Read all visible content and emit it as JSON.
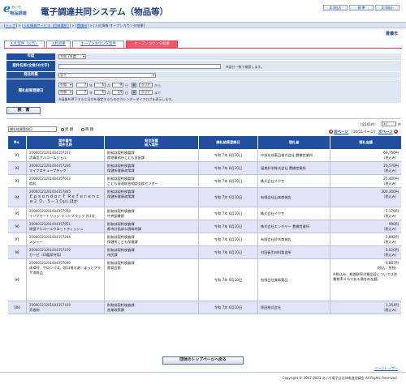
{
  "header": {
    "logo_letter": "e",
    "logo_brand": "あいち",
    "logo_sub": "物品調達",
    "title": "電子調達共同システム（物品等）",
    "buttons": [
      "文字拡大",
      "標 準",
      "文字縮小"
    ]
  },
  "breadcrumb": {
    "items": [
      "トップ",
      "入札情報サービス（団体選択）",
      "豊橋市",
      "入札情報-オープンカウンタ結果"
    ]
  },
  "organization": "豊橋市",
  "tabs": [
    {
      "label": "入札案件（公告）",
      "active": false
    },
    {
      "label": "入札結果",
      "active": false
    },
    {
      "label": "オープンカウンタ案件",
      "active": false
    },
    {
      "label": "オープンカウンタ結果",
      "active": true
    }
  ],
  "search": {
    "year_label": "年度",
    "year_value": "令和 7年度",
    "name_label": "案件名称",
    "name_sub": "(全角50文字)",
    "name_value": "",
    "name_note": "※部分一致で検索します。",
    "dept_label": "発注所属",
    "dept_value": "全て",
    "date_label": "開札結果登録日",
    "from": {
      "era": "令和",
      "year": "7",
      "month": "6",
      "day": "9"
    },
    "to": {
      "era": "令和",
      "year": "7",
      "month": "6",
      "day": "14"
    },
    "unit_year": "年",
    "unit_month": "月",
    "unit_day": "日",
    "clear": "クリア",
    "from_suffix": "から",
    "to_suffix": "まで",
    "cal_icon": "calendar-icon",
    "date_note": "※画像を押下すると日付を指定するためのカレンダーダイアログを表示します。",
    "search_button": "検　索"
  },
  "results": {
    "sort_value": "開札結果登録日",
    "order_asc": "昇 順",
    "order_desc": "降 順",
    "count_text": "（全101件）",
    "per_page": "10",
    "per_page_unit": "件",
    "prev": "前ページ",
    "page_info": "（10/11ページ）",
    "next": "次ページ"
  },
  "table": {
    "headers": {
      "no": "No.",
      "case_no": "案件番号",
      "case_name": "案件名称",
      "dept": "発注所属",
      "place": "納入場所",
      "date": "開札結果登録日",
      "winner": "落札者",
      "amount": "落札金額"
    },
    "rows": [
      {
        "no": "91",
        "case_no": "20060123201004357107",
        "case_name": "消毒用アルコールジェル",
        "dept": "財務部契約検査課",
        "place": "陸地事務所こども家庭課",
        "date": "令和 7年 6月10日",
        "winner": "中部化成薬品株式会社 豊橋営業所",
        "amount": "66,750円",
        "tax": "（税込み）",
        "note": ""
      },
      {
        "no": "92",
        "case_no": "20060123201004357206",
        "case_name": "マイクロチューブラック",
        "dept": "財務部契約検査課",
        "place": "保健所健康政策課",
        "date": "令和 7年 6月10日",
        "winner": "渥美科学株式会社 豊橋営業所",
        "amount": "20,570円",
        "tax": "（税込み）",
        "note": ""
      },
      {
        "no": "93",
        "case_no": "20060123201004357643",
        "case_name": "扇机",
        "dept": "財務部契約検査課",
        "place": "こども発達総合相談支援センター",
        "date": "令和 7年 6月10日",
        "winner": "株式会社イクモ",
        "amount": "25,400円",
        "tax": "（税込み）",
        "note": ""
      },
      {
        "no": "94",
        "case_no": "20060123201004357845",
        "case_name": "Ｅｐｓｏｎｄｏｒｆ Ｒｅｆｅｒｅｎｃｅ２ Ｄ、５－１０μＬほか",
        "dept": "財務部契約検査課",
        "place": "保健所健康政策課",
        "date": "令和 7年 6月10日",
        "winner": "有限会社山本商城店",
        "amount": "300,300円",
        "tax": "（税込み）",
        "note": ""
      },
      {
        "no": "95",
        "case_no": "20060123201004357938",
        "case_name": "インクカートリッジ マットブラック 外3点",
        "dept": "財務部契約検査課",
        "place": "中央図書館",
        "date": "令和 7年 6月10日",
        "winner": "株式会社イクモ",
        "amount": "5,170円",
        "tax": "（税込み）",
        "note": ""
      },
      {
        "no": "96",
        "case_no": "20060123201004357951",
        "case_name": "除菌アルコールウエットティッシュ",
        "dept": "財務部契約検査課",
        "place": "都市計画部公園緑地課",
        "date": "令和 7年 6月10日",
        "winner": "株式会社エンチヤー 豊橋営業所",
        "amount": "990円",
        "tax": "（税込み）",
        "note": ""
      },
      {
        "no": "97",
        "case_no": "20060123201004357204",
        "case_name": "メジャー",
        "dept": "財務部契約検査課",
        "place": "保健所こども保健課",
        "date": "令和 7年 6月10日",
        "winner": "有限会社鈴木商城店",
        "amount": "1,892円",
        "tax": "（税込み）",
        "note": ""
      },
      {
        "no": "98",
        "case_no": "20060123201004357159",
        "case_name": "ガーゼ（印鑑保持用）",
        "dept": "財務部契約検査課",
        "place": "市民課",
        "date": "令和 7年 6月10日",
        "winner": "村田衛生材料製造所",
        "amount": "5,520円",
        "tax": "（税込み）",
        "note": ""
      },
      {
        "no": "99",
        "case_no": "20060123201004357090",
        "case_name": "床掃除、サロンパス、超ロ唾水溶：ほっとプラザ消耗品",
        "dept": "財務部契約検査課",
        "place": "教育会館",
        "date": "令和 7年 6月10日",
        "winner": "有限会社美郎薬品",
        "amount": "6,867円",
        "tax": "（税込／免税）",
        "note": "※税込み、軽減税率対象品目については消費税率８％である場合の金額。"
      },
      {
        "no": "100",
        "case_no": "20060123201004357109",
        "case_name": "芳香剤",
        "dept": "財務部契約検査課",
        "place": "産業政策課",
        "date": "令和 7年 6月10日",
        "winner": "原田株式会社",
        "amount": "1,354円",
        "tax": "（税込み）",
        "note": ""
      }
    ]
  },
  "footer": {
    "top_button": "団体のトップページへ戻る",
    "page_top": "ページトップへ",
    "copyright": "Copyright © 2007-2021 あいち電子自治体推進協議会 All Rights Reserved."
  },
  "colors": {
    "header_blue": "#1f4f9e",
    "active_tab": "#f2546a",
    "row_alt": "#e1e4f7"
  }
}
